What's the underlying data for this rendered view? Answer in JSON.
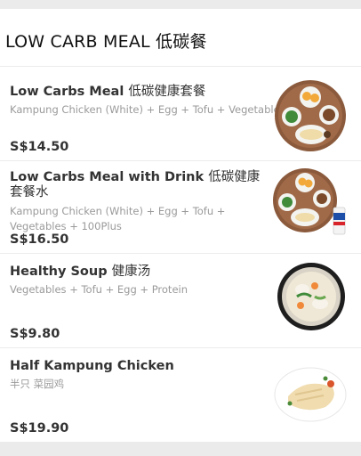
{
  "section": {
    "title": "LOW CARB MEAL 低碳餐"
  },
  "items": [
    {
      "name": "Low Carbs Meal",
      "name_cn": "低碳健康套餐",
      "description": "Kampung Chicken (White) + Egg + Tofu + Vegetables",
      "price": "S$14.50",
      "image_icon": "chicken-rice-platter-image"
    },
    {
      "name": "Low Carbs Meal with Drink",
      "name_cn": "低碳健康套餐水",
      "description": "Kampung Chicken (White) + Egg + Tofu + Vegetables + 100Plus",
      "price": "S$16.50",
      "image_icon": "platter-with-drink-image"
    },
    {
      "name": "Healthy Soup",
      "name_cn": "健康汤",
      "description": "Vegetables + Tofu + Egg + Protein",
      "price": "S$9.80",
      "image_icon": "soup-bowl-image"
    },
    {
      "name": "Half Kampung Chicken",
      "name_cn": "",
      "description": "半只 菜园鸡",
      "price": "S$19.90",
      "image_icon": "sliced-chicken-plate-image"
    }
  ]
}
